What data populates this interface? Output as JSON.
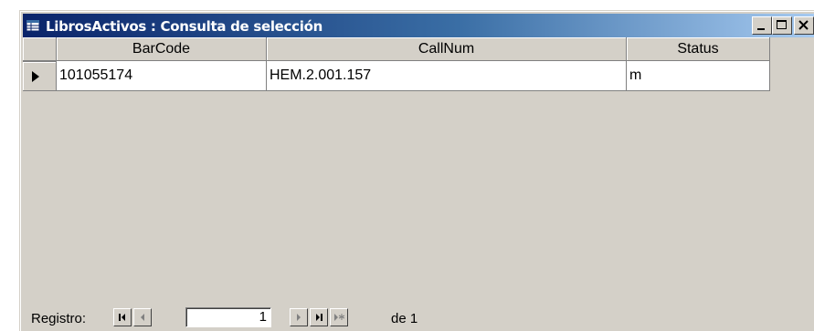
{
  "window": {
    "title": "LibrosActivos : Consulta de selección",
    "controls": {
      "minimize": "minimize",
      "maximize": "maximize",
      "close": "close"
    }
  },
  "table": {
    "columns": [
      "BarCode",
      "CallNum",
      "Status"
    ],
    "rows": [
      {
        "BarCode": "101055174",
        "CallNum": "HEM.2.001.157",
        "Status": "m"
      }
    ]
  },
  "navigation": {
    "label": "Registro:",
    "current_record": "1",
    "total_prefix": "de",
    "total": "1"
  }
}
